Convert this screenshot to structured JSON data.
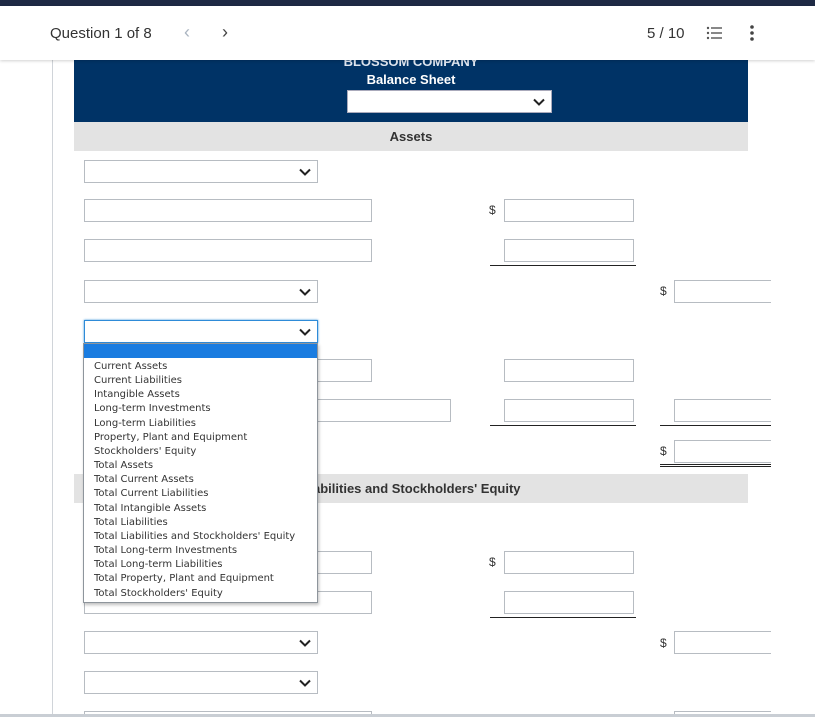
{
  "topbar": {
    "question_label": "Question 1 of 8",
    "prev_icon": "chevron-left-icon",
    "next_icon": "chevron-right-icon",
    "prev_glyph": "‹",
    "next_glyph": "›",
    "progress": "5 / 10",
    "list_icon": "list-icon",
    "more_icon": "more-vertical-icon"
  },
  "sheet": {
    "company": "BLOSSOM COMPANY",
    "statement": "Balance Sheet",
    "date_select_value": "",
    "assets_heading": "Assets",
    "liabilities_heading": "Liabilities and Stockholders' Equity",
    "currency_symbol": "$"
  },
  "dropdown": {
    "selected_value": "",
    "options": [
      "Current Assets",
      "Current Liabilities",
      "Intangible Assets",
      "Long-term Investments",
      "Long-term Liabilities",
      "Property, Plant and Equipment",
      "Stockholders' Equity",
      "Total Assets",
      "Total Current Assets",
      "Total Current Liabilities",
      "Total Intangible Assets",
      "Total Liabilities",
      "Total Liabilities and Stockholders' Equity",
      "Total Long-term Investments",
      "Total Long-term Liabilities",
      "Total Property, Plant and Equipment",
      "Total Stockholders' Equity"
    ]
  },
  "colors": {
    "header_band": "#003366",
    "section_band": "#e3e3e3",
    "highlight": "#1a7ce0",
    "top_strip": "#1e2a44"
  }
}
